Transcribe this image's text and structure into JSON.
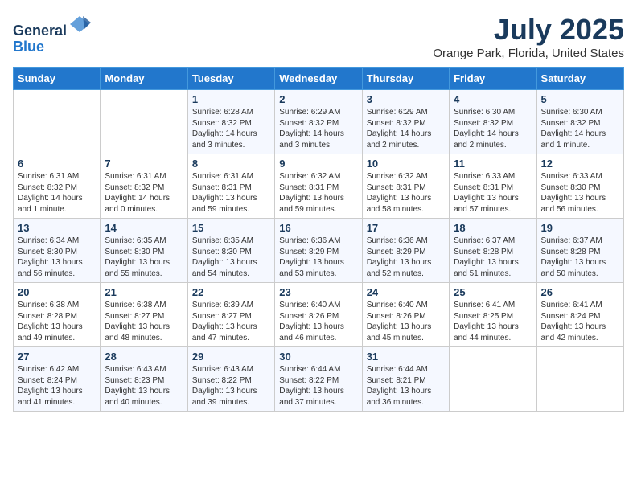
{
  "header": {
    "logo_general": "General",
    "logo_blue": "Blue",
    "title": "July 2025",
    "location": "Orange Park, Florida, United States"
  },
  "days_of_week": [
    "Sunday",
    "Monday",
    "Tuesday",
    "Wednesday",
    "Thursday",
    "Friday",
    "Saturday"
  ],
  "weeks": [
    [
      {
        "day": "",
        "info": ""
      },
      {
        "day": "",
        "info": ""
      },
      {
        "day": "1",
        "info": "Sunrise: 6:28 AM\nSunset: 8:32 PM\nDaylight: 14 hours and 3 minutes."
      },
      {
        "day": "2",
        "info": "Sunrise: 6:29 AM\nSunset: 8:32 PM\nDaylight: 14 hours and 3 minutes."
      },
      {
        "day": "3",
        "info": "Sunrise: 6:29 AM\nSunset: 8:32 PM\nDaylight: 14 hours and 2 minutes."
      },
      {
        "day": "4",
        "info": "Sunrise: 6:30 AM\nSunset: 8:32 PM\nDaylight: 14 hours and 2 minutes."
      },
      {
        "day": "5",
        "info": "Sunrise: 6:30 AM\nSunset: 8:32 PM\nDaylight: 14 hours and 1 minute."
      }
    ],
    [
      {
        "day": "6",
        "info": "Sunrise: 6:31 AM\nSunset: 8:32 PM\nDaylight: 14 hours and 1 minute."
      },
      {
        "day": "7",
        "info": "Sunrise: 6:31 AM\nSunset: 8:32 PM\nDaylight: 14 hours and 0 minutes."
      },
      {
        "day": "8",
        "info": "Sunrise: 6:31 AM\nSunset: 8:31 PM\nDaylight: 13 hours and 59 minutes."
      },
      {
        "day": "9",
        "info": "Sunrise: 6:32 AM\nSunset: 8:31 PM\nDaylight: 13 hours and 59 minutes."
      },
      {
        "day": "10",
        "info": "Sunrise: 6:32 AM\nSunset: 8:31 PM\nDaylight: 13 hours and 58 minutes."
      },
      {
        "day": "11",
        "info": "Sunrise: 6:33 AM\nSunset: 8:31 PM\nDaylight: 13 hours and 57 minutes."
      },
      {
        "day": "12",
        "info": "Sunrise: 6:33 AM\nSunset: 8:30 PM\nDaylight: 13 hours and 56 minutes."
      }
    ],
    [
      {
        "day": "13",
        "info": "Sunrise: 6:34 AM\nSunset: 8:30 PM\nDaylight: 13 hours and 56 minutes."
      },
      {
        "day": "14",
        "info": "Sunrise: 6:35 AM\nSunset: 8:30 PM\nDaylight: 13 hours and 55 minutes."
      },
      {
        "day": "15",
        "info": "Sunrise: 6:35 AM\nSunset: 8:30 PM\nDaylight: 13 hours and 54 minutes."
      },
      {
        "day": "16",
        "info": "Sunrise: 6:36 AM\nSunset: 8:29 PM\nDaylight: 13 hours and 53 minutes."
      },
      {
        "day": "17",
        "info": "Sunrise: 6:36 AM\nSunset: 8:29 PM\nDaylight: 13 hours and 52 minutes."
      },
      {
        "day": "18",
        "info": "Sunrise: 6:37 AM\nSunset: 8:28 PM\nDaylight: 13 hours and 51 minutes."
      },
      {
        "day": "19",
        "info": "Sunrise: 6:37 AM\nSunset: 8:28 PM\nDaylight: 13 hours and 50 minutes."
      }
    ],
    [
      {
        "day": "20",
        "info": "Sunrise: 6:38 AM\nSunset: 8:28 PM\nDaylight: 13 hours and 49 minutes."
      },
      {
        "day": "21",
        "info": "Sunrise: 6:38 AM\nSunset: 8:27 PM\nDaylight: 13 hours and 48 minutes."
      },
      {
        "day": "22",
        "info": "Sunrise: 6:39 AM\nSunset: 8:27 PM\nDaylight: 13 hours and 47 minutes."
      },
      {
        "day": "23",
        "info": "Sunrise: 6:40 AM\nSunset: 8:26 PM\nDaylight: 13 hours and 46 minutes."
      },
      {
        "day": "24",
        "info": "Sunrise: 6:40 AM\nSunset: 8:26 PM\nDaylight: 13 hours and 45 minutes."
      },
      {
        "day": "25",
        "info": "Sunrise: 6:41 AM\nSunset: 8:25 PM\nDaylight: 13 hours and 44 minutes."
      },
      {
        "day": "26",
        "info": "Sunrise: 6:41 AM\nSunset: 8:24 PM\nDaylight: 13 hours and 42 minutes."
      }
    ],
    [
      {
        "day": "27",
        "info": "Sunrise: 6:42 AM\nSunset: 8:24 PM\nDaylight: 13 hours and 41 minutes."
      },
      {
        "day": "28",
        "info": "Sunrise: 6:43 AM\nSunset: 8:23 PM\nDaylight: 13 hours and 40 minutes."
      },
      {
        "day": "29",
        "info": "Sunrise: 6:43 AM\nSunset: 8:22 PM\nDaylight: 13 hours and 39 minutes."
      },
      {
        "day": "30",
        "info": "Sunrise: 6:44 AM\nSunset: 8:22 PM\nDaylight: 13 hours and 37 minutes."
      },
      {
        "day": "31",
        "info": "Sunrise: 6:44 AM\nSunset: 8:21 PM\nDaylight: 13 hours and 36 minutes."
      },
      {
        "day": "",
        "info": ""
      },
      {
        "day": "",
        "info": ""
      }
    ]
  ]
}
